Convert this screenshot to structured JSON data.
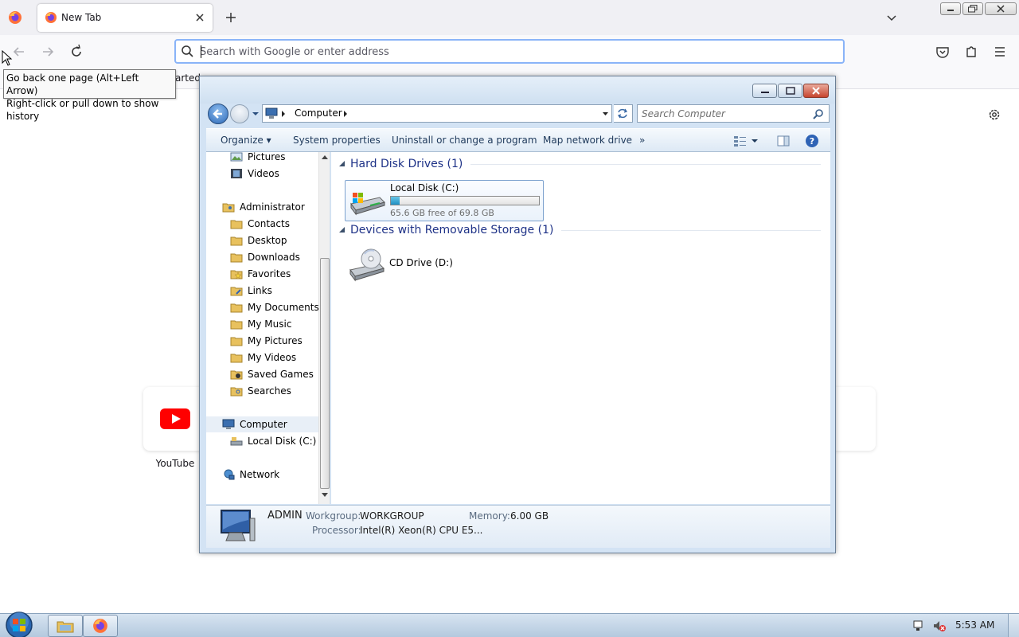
{
  "browser": {
    "tab_title": "New Tab",
    "url_placeholder": "Search with Google or enter address",
    "bookmarks_partial_text": "arted",
    "tooltip": {
      "line1": "Go back one page (Alt+Left Arrow)",
      "line2": "Right-click or pull down to show history"
    },
    "top_sites": [
      {
        "label": "YouTube",
        "icon": "youtube-icon"
      }
    ]
  },
  "explorer": {
    "address_crumb": "Computer",
    "search_placeholder": "Search Computer",
    "commands": {
      "organize": "Organize",
      "system_properties": "System properties",
      "uninstall": "Uninstall or change a program",
      "map_drive": "Map network drive",
      "more": "»"
    },
    "nav_items": [
      {
        "label": "Pictures",
        "icon": "pictures-icon"
      },
      {
        "label": "Videos",
        "icon": "videos-icon"
      },
      {
        "label": "Administrator",
        "icon": "user-folder-icon"
      },
      {
        "label": "Contacts",
        "icon": "folder-icon"
      },
      {
        "label": "Desktop",
        "icon": "folder-icon"
      },
      {
        "label": "Downloads",
        "icon": "folder-icon"
      },
      {
        "label": "Favorites",
        "icon": "favorites-icon"
      },
      {
        "label": "Links",
        "icon": "folder-icon"
      },
      {
        "label": "My Documents",
        "icon": "folder-icon"
      },
      {
        "label": "My Music",
        "icon": "folder-icon"
      },
      {
        "label": "My Pictures",
        "icon": "folder-icon"
      },
      {
        "label": "My Videos",
        "icon": "folder-icon"
      },
      {
        "label": "Saved Games",
        "icon": "folder-icon"
      },
      {
        "label": "Searches",
        "icon": "folder-icon"
      },
      {
        "label": "Computer",
        "icon": "computer-icon"
      },
      {
        "label": "Local Disk (C:)",
        "icon": "drive-icon"
      },
      {
        "label": "Network",
        "icon": "network-icon"
      }
    ],
    "groups": {
      "hdd": "Hard Disk Drives (1)",
      "removable": "Devices with Removable Storage (1)"
    },
    "local_disk": {
      "name": "Local Disk (C:)",
      "free_text": "65.6 GB free of 69.8 GB",
      "used_fraction": 0.06
    },
    "cd_drive": {
      "name": "CD Drive (D:)"
    },
    "details": {
      "computer_name": "ADMIN",
      "workgroup_label": "Workgroup:",
      "workgroup_value": "WORKGROUP",
      "memory_label": "Memory:",
      "memory_value": "6.00 GB",
      "processor_label": "Processor:",
      "processor_value": "Intel(R) Xeon(R) CPU E5..."
    }
  },
  "taskbar": {
    "clock": "5:53 AM"
  },
  "colors": {
    "explorer_header_blue": "#1e3287",
    "url_focus": "#8ab4f8",
    "youtube_red": "#ff0000"
  }
}
